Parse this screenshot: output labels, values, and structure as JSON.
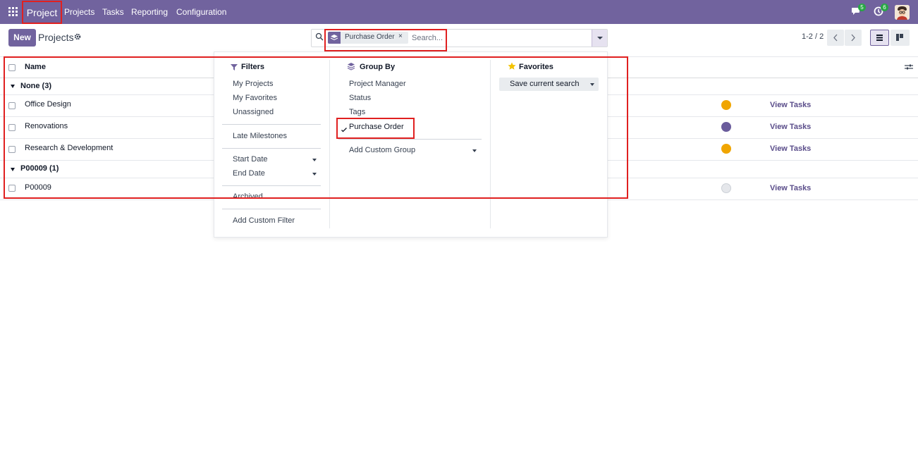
{
  "navbar": {
    "app_name": "Project",
    "menu": [
      "Projects",
      "Tasks",
      "Reporting",
      "Configuration"
    ],
    "messages_badge": "5",
    "activities_badge": "6"
  },
  "control_panel": {
    "new_label": "New",
    "breadcrumb": "Projects",
    "search": {
      "facet_label": "Purchase Order",
      "placeholder": "Search..."
    },
    "pager": "1-2 / 2"
  },
  "list": {
    "header_name": "Name",
    "groups": [
      {
        "label": "None (3)",
        "rows": [
          {
            "name": "Office Design",
            "action": "View Tasks",
            "status_color": "#f0a500"
          },
          {
            "name": "Renovations",
            "action": "View Tasks",
            "status_color": "#6a5c9c"
          },
          {
            "name": "Research & Development",
            "action": "View Tasks",
            "status_color": "#f0a500"
          }
        ]
      },
      {
        "label": "P00009 (1)",
        "rows": [
          {
            "name": "P00009",
            "action": "View Tasks",
            "status_color": "#e5e7eb"
          }
        ]
      }
    ]
  },
  "dropdown": {
    "filters": {
      "title": "Filters",
      "items": [
        "My Projects",
        "My Favorites",
        "Unassigned",
        "Late Milestones",
        "Start Date",
        "End Date",
        "Archived",
        "Add Custom Filter"
      ]
    },
    "group_by": {
      "title": "Group By",
      "items": [
        "Project Manager",
        "Status",
        "Tags",
        "Purchase Order",
        "Add Custom Group"
      ]
    },
    "favorites": {
      "title": "Favorites",
      "save_label": "Save current search"
    }
  },
  "colors": {
    "brand": "#71639e",
    "highlight": "#e02020"
  }
}
